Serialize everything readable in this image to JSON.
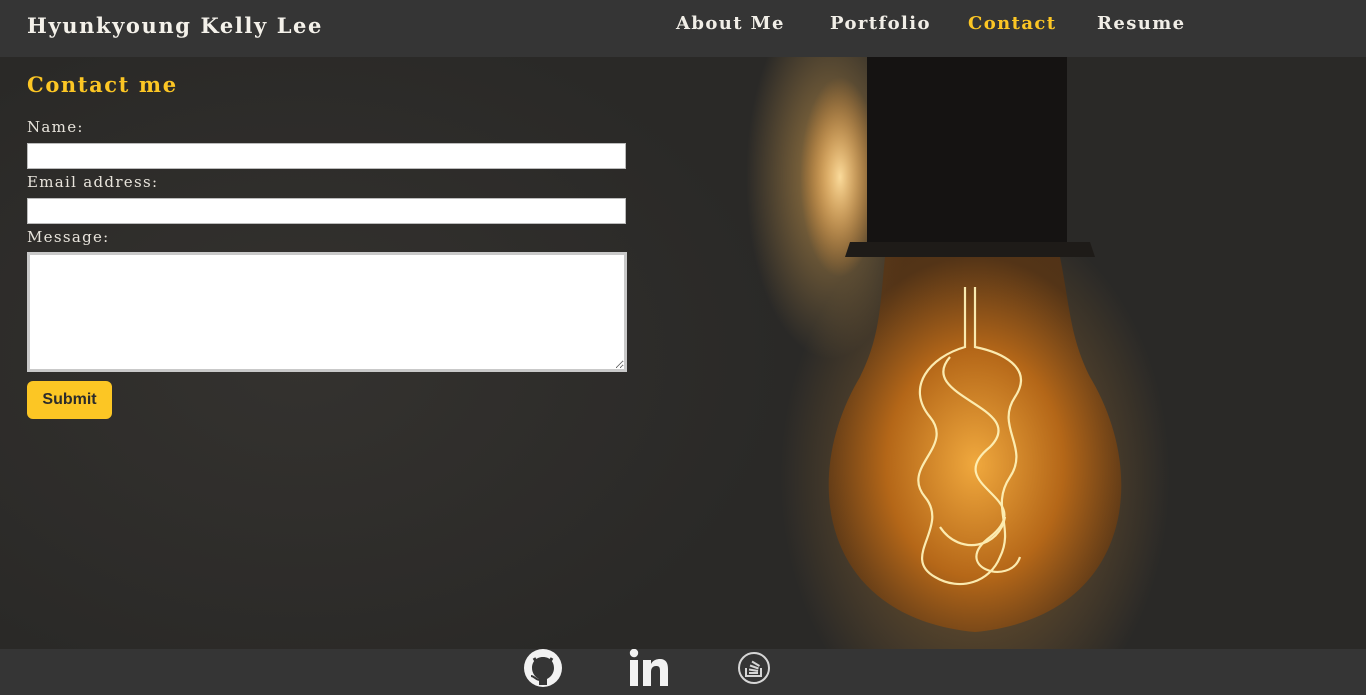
{
  "header": {
    "brand": "Hyunkyoung Kelly Lee",
    "nav": [
      {
        "label": "About Me"
      },
      {
        "label": "Portfolio"
      },
      {
        "label": "Contact"
      },
      {
        "label": "Resume"
      }
    ],
    "active_nav": "Contact"
  },
  "contact": {
    "title": "Contact me",
    "name_label": "Name:",
    "name_value": "",
    "email_label": "Email address:",
    "email_value": "",
    "message_label": "Message:",
    "message_value": "",
    "submit_label": "Submit"
  },
  "footer": {
    "icons": [
      "github-icon",
      "linkedin-icon",
      "stackoverflow-icon"
    ]
  },
  "colors": {
    "accent": "#fcc624",
    "bar": "#353535",
    "text": "#f1eee7"
  }
}
